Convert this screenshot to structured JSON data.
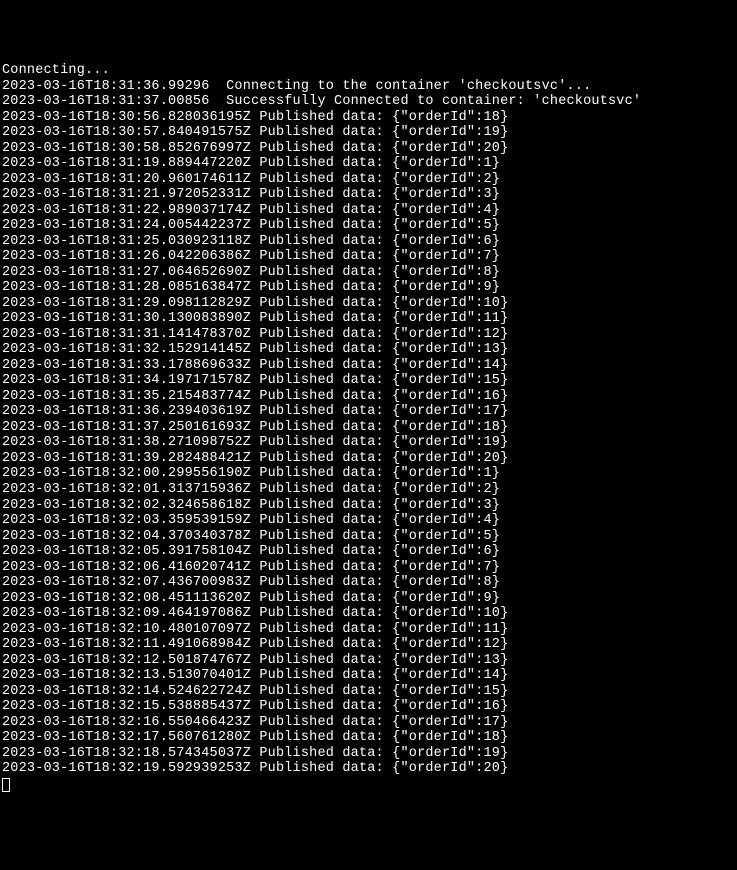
{
  "header": {
    "connecting": "Connecting...",
    "connectLine": "2023-03-16T18:31:36.99296  Connecting to the container 'checkoutsvc'...",
    "successLine": "2023-03-16T18:31:37.00856  Successfully Connected to container: 'checkoutsvc' "
  },
  "logPrefix": "Published data:",
  "entries": [
    {
      "ts": "2023-03-16T18:30:56.828036195Z",
      "orderId": 18
    },
    {
      "ts": "2023-03-16T18:30:57.840491575Z",
      "orderId": 19
    },
    {
      "ts": "2023-03-16T18:30:58.852676997Z",
      "orderId": 20
    },
    {
      "ts": "2023-03-16T18:31:19.889447220Z",
      "orderId": 1
    },
    {
      "ts": "2023-03-16T18:31:20.960174611Z",
      "orderId": 2
    },
    {
      "ts": "2023-03-16T18:31:21.972052331Z",
      "orderId": 3
    },
    {
      "ts": "2023-03-16T18:31:22.989037174Z",
      "orderId": 4
    },
    {
      "ts": "2023-03-16T18:31:24.005442237Z",
      "orderId": 5
    },
    {
      "ts": "2023-03-16T18:31:25.030923118Z",
      "orderId": 6
    },
    {
      "ts": "2023-03-16T18:31:26.042206386Z",
      "orderId": 7
    },
    {
      "ts": "2023-03-16T18:31:27.064652690Z",
      "orderId": 8
    },
    {
      "ts": "2023-03-16T18:31:28.085163847Z",
      "orderId": 9
    },
    {
      "ts": "2023-03-16T18:31:29.098112829Z",
      "orderId": 10
    },
    {
      "ts": "2023-03-16T18:31:30.130083890Z",
      "orderId": 11
    },
    {
      "ts": "2023-03-16T18:31:31.141478370Z",
      "orderId": 12
    },
    {
      "ts": "2023-03-16T18:31:32.152914145Z",
      "orderId": 13
    },
    {
      "ts": "2023-03-16T18:31:33.178869633Z",
      "orderId": 14
    },
    {
      "ts": "2023-03-16T18:31:34.197171578Z",
      "orderId": 15
    },
    {
      "ts": "2023-03-16T18:31:35.215483774Z",
      "orderId": 16
    },
    {
      "ts": "2023-03-16T18:31:36.239403619Z",
      "orderId": 17
    },
    {
      "ts": "2023-03-16T18:31:37.250161693Z",
      "orderId": 18
    },
    {
      "ts": "2023-03-16T18:31:38.271098752Z",
      "orderId": 19
    },
    {
      "ts": "2023-03-16T18:31:39.282488421Z",
      "orderId": 20
    },
    {
      "ts": "2023-03-16T18:32:00.299556190Z",
      "orderId": 1
    },
    {
      "ts": "2023-03-16T18:32:01.313715936Z",
      "orderId": 2
    },
    {
      "ts": "2023-03-16T18:32:02.324658618Z",
      "orderId": 3
    },
    {
      "ts": "2023-03-16T18:32:03.359539159Z",
      "orderId": 4
    },
    {
      "ts": "2023-03-16T18:32:04.370340378Z",
      "orderId": 5
    },
    {
      "ts": "2023-03-16T18:32:05.391758104Z",
      "orderId": 6
    },
    {
      "ts": "2023-03-16T18:32:06.416020741Z",
      "orderId": 7
    },
    {
      "ts": "2023-03-16T18:32:07.436700983Z",
      "orderId": 8
    },
    {
      "ts": "2023-03-16T18:32:08.451113620Z",
      "orderId": 9
    },
    {
      "ts": "2023-03-16T18:32:09.464197086Z",
      "orderId": 10
    },
    {
      "ts": "2023-03-16T18:32:10.480107097Z",
      "orderId": 11
    },
    {
      "ts": "2023-03-16T18:32:11.491068984Z",
      "orderId": 12
    },
    {
      "ts": "2023-03-16T18:32:12.501874767Z",
      "orderId": 13
    },
    {
      "ts": "2023-03-16T18:32:13.513070401Z",
      "orderId": 14
    },
    {
      "ts": "2023-03-16T18:32:14.524622724Z",
      "orderId": 15
    },
    {
      "ts": "2023-03-16T18:32:15.538885437Z",
      "orderId": 16
    },
    {
      "ts": "2023-03-16T18:32:16.550466423Z",
      "orderId": 17
    },
    {
      "ts": "2023-03-16T18:32:17.560761280Z",
      "orderId": 18
    },
    {
      "ts": "2023-03-16T18:32:18.574345037Z",
      "orderId": 19
    },
    {
      "ts": "2023-03-16T18:32:19.592939253Z",
      "orderId": 20
    }
  ]
}
